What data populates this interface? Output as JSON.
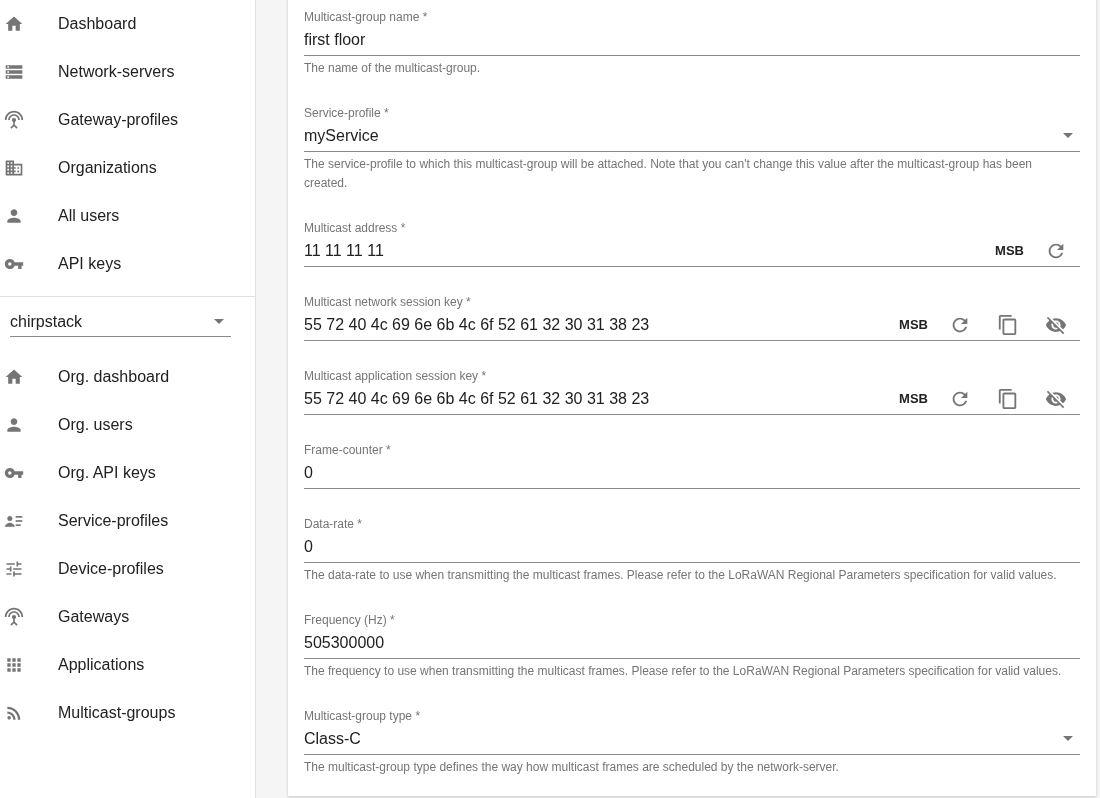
{
  "sidebar": {
    "admin_items": [
      {
        "label": "Dashboard"
      },
      {
        "label": "Network-servers"
      },
      {
        "label": "Gateway-profiles"
      },
      {
        "label": "Organizations"
      },
      {
        "label": "All users"
      },
      {
        "label": "API keys"
      }
    ],
    "organization_select": {
      "value": "chirpstack"
    },
    "org_items": [
      {
        "label": "Org. dashboard"
      },
      {
        "label": "Org. users"
      },
      {
        "label": "Org. API keys"
      },
      {
        "label": "Service-profiles"
      },
      {
        "label": "Device-profiles"
      },
      {
        "label": "Gateways"
      },
      {
        "label": "Applications"
      },
      {
        "label": "Multicast-groups"
      }
    ]
  },
  "form": {
    "fields": [
      {
        "kind": "text",
        "label": "Multicast-group name *",
        "value": "first floor",
        "helper": "The name of the multicast-group."
      },
      {
        "kind": "select",
        "label": "Service-profile *",
        "value": "myService",
        "helper": "The service-profile to which this multicast-group will be attached. Note that you can't change this value after the multicast-group has been created."
      },
      {
        "kind": "text",
        "label": "Multicast address *",
        "value": "11 11 11 11",
        "adornments": [
          {
            "kind": "text",
            "label": "MSB"
          },
          {
            "kind": "refresh"
          }
        ]
      },
      {
        "kind": "text",
        "label": "Multicast network session key *",
        "value": "55 72 40 4c 69 6e 6b 4c 6f 52 61 32 30 31 38 23",
        "adornments": [
          {
            "kind": "text",
            "label": "MSB"
          },
          {
            "kind": "refresh"
          },
          {
            "kind": "copy"
          },
          {
            "kind": "hide"
          }
        ]
      },
      {
        "kind": "text",
        "label": "Multicast application session key *",
        "value": "55 72 40 4c 69 6e 6b 4c 6f 52 61 32 30 31 38 23",
        "adornments": [
          {
            "kind": "text",
            "label": "MSB"
          },
          {
            "kind": "refresh"
          },
          {
            "kind": "copy"
          },
          {
            "kind": "hide"
          }
        ]
      },
      {
        "kind": "text",
        "label": "Frame-counter *",
        "value": "0"
      },
      {
        "kind": "text",
        "label": "Data-rate *",
        "value": "0",
        "helper": "The data-rate to use when transmitting the multicast frames. Please refer to the LoRaWAN Regional Parameters specification for valid values."
      },
      {
        "kind": "text",
        "label": "Frequency (Hz) *",
        "value": "505300000",
        "helper": "The frequency to use when transmitting the multicast frames. Please refer to the LoRaWAN Regional Parameters specification for valid values."
      },
      {
        "kind": "select",
        "label": "Multicast-group type *",
        "value": "Class-C",
        "helper": "The multicast-group type defines the way how multicast frames are scheduled by the network-server."
      }
    ]
  }
}
